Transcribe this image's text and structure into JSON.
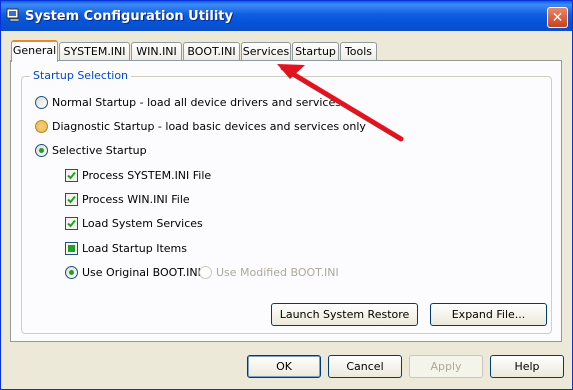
{
  "window": {
    "title": "System Configuration Utility",
    "close_glyph": "✕"
  },
  "tabs": [
    {
      "label": "General",
      "active": true
    },
    {
      "label": "SYSTEM.INI"
    },
    {
      "label": "WIN.INI"
    },
    {
      "label": "BOOT.INI"
    },
    {
      "label": "Services"
    },
    {
      "label": "Startup"
    },
    {
      "label": "Tools"
    }
  ],
  "startup_selection": {
    "label": "Startup Selection",
    "options": {
      "normal": "Normal Startup - load all device drivers and services",
      "diagnostic": "Diagnostic Startup - load basic devices and services only",
      "selective": "Selective Startup"
    },
    "selected": "selective"
  },
  "selective_items": {
    "process_system_ini": {
      "label": "Process SYSTEM.INI File",
      "state": "checked"
    },
    "process_win_ini": {
      "label": "Process WIN.INI File",
      "state": "checked"
    },
    "load_system_services": {
      "label": "Load System Services",
      "state": "checked"
    },
    "load_startup_items": {
      "label": "Load Startup Items",
      "state": "indeterminate"
    }
  },
  "boot_ini": {
    "original": "Use Original BOOT.INI",
    "modified": "Use Modified BOOT.INI",
    "selected": "original"
  },
  "buttons": {
    "launch_restore": "Launch System Restore",
    "expand_file": "Expand File...",
    "ok": "OK",
    "cancel": "Cancel",
    "apply": "Apply",
    "help": "Help"
  },
  "colors": {
    "titlebar": "#0553d9",
    "group_label": "#0046d5",
    "annotation_arrow": "#e0141e"
  }
}
